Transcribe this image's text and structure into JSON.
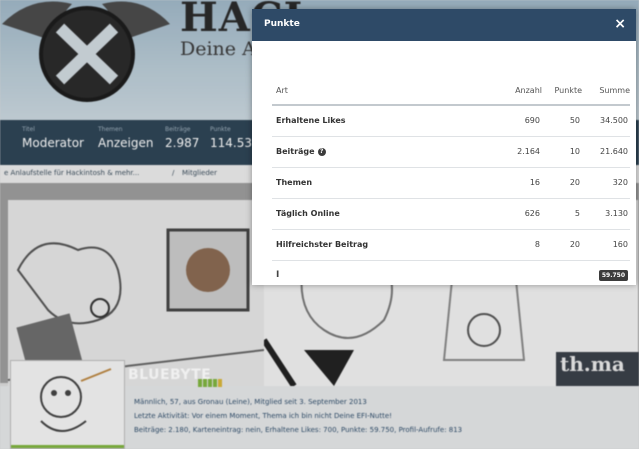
{
  "site": {
    "title": "HACI",
    "subtitle": "Deine A"
  },
  "stats": [
    {
      "label": "Titel",
      "value": "Moderator"
    },
    {
      "label": "Themen",
      "value": "Anzeigen"
    },
    {
      "label": "Beiträge",
      "value": "2.987"
    },
    {
      "label": "Punkte",
      "value": "114.53"
    }
  ],
  "breadcrumb": {
    "home": "e Anlaufstelle für Hackintosh & mehr...",
    "separator": "/",
    "current": "Mitglieder"
  },
  "cover": {
    "thomas_text": "th.ma"
  },
  "profile": {
    "username": "BLUEBYTE",
    "rank_bar": [
      "green",
      "green",
      "green",
      "green",
      "yellow"
    ],
    "line1": "Männlich, 57, aus Gronau (Leine), Mitglied seit 3. September 2013",
    "line2": "Letzte Aktivität: Vor einem Moment, Thema ich bin nicht Deine EFI-Nutte!",
    "line3": "Beiträge: 2.180, Karteneintrag: nein, Erhaltene Likes: 700, Punkte: 59.750, Profil-Aufrufe: 813"
  },
  "modal": {
    "title": "Punkte",
    "close_icon": "×",
    "columns": {
      "art": "Art",
      "anzahl": "Anzahl",
      "punkte": "Punkte",
      "summe": "Summe"
    },
    "rows": [
      {
        "art": "Erhaltene Likes",
        "anzahl": "690",
        "punkte": "50",
        "summe": "34.500",
        "info": false
      },
      {
        "art": "Beiträge",
        "anzahl": "2.164",
        "punkte": "10",
        "summe": "21.640",
        "info": true
      },
      {
        "art": "Themen",
        "anzahl": "16",
        "punkte": "20",
        "summe": "320",
        "info": false
      },
      {
        "art": "Täglich Online",
        "anzahl": "626",
        "punkte": "5",
        "summe": "3.130",
        "info": false
      },
      {
        "art": "Hilfreichster Beitrag",
        "anzahl": "8",
        "punkte": "20",
        "summe": "160",
        "info": false
      }
    ],
    "total_label": "I",
    "total": "59.750"
  }
}
